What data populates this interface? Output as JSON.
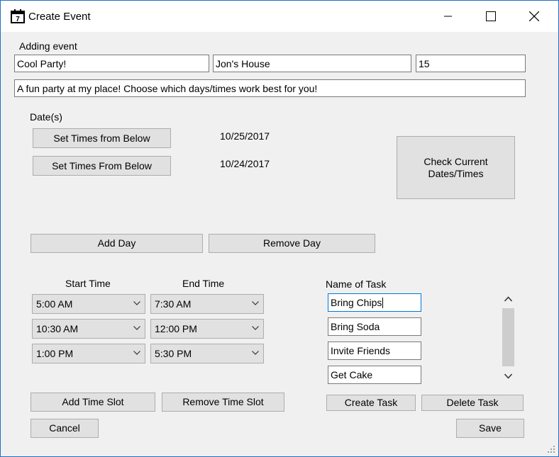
{
  "window": {
    "title": "Create Event",
    "icon": "calendar-icon",
    "icon_number": "7",
    "controls": [
      "minimize-icon",
      "maximize-icon",
      "close-icon"
    ]
  },
  "event": {
    "heading": "Adding event",
    "name_value": "Cool Party!",
    "location_value": "Jon's House",
    "capacity_value": "15",
    "description_value": "A fun party at my place! Choose which days/times work best for you!"
  },
  "dates": {
    "heading": "Date(s)",
    "rows": [
      {
        "button_label": "Set Times from Below",
        "date": "10/25/2017"
      },
      {
        "button_label": "Set Times From Below",
        "date": "10/24/2017"
      }
    ],
    "check_button_label": "Check Current\nDates/Times",
    "add_day_label": "Add Day",
    "remove_day_label": "Remove Day"
  },
  "times": {
    "start_header": "Start Time",
    "end_header": "End Time",
    "slots": [
      {
        "start": "5:00 AM",
        "end": "7:30 AM"
      },
      {
        "start": "10:30 AM",
        "end": "12:00 PM"
      },
      {
        "start": "1:00 PM",
        "end": "5:30 PM"
      }
    ],
    "add_slot_label": "Add Time Slot",
    "remove_slot_label": "Remove Time Slot"
  },
  "tasks": {
    "header": "Name of Task",
    "items": [
      "Bring Chips",
      "Bring Soda",
      "Invite Friends",
      "Get Cake"
    ],
    "create_label": "Create Task",
    "delete_label": "Delete Task"
  },
  "footer": {
    "cancel_label": "Cancel",
    "save_label": "Save"
  },
  "colors": {
    "window_border": "#1e6fc4",
    "form_background": "#f0f0f0",
    "button_face": "#e1e1e1",
    "focus_border": "#0078d7"
  }
}
